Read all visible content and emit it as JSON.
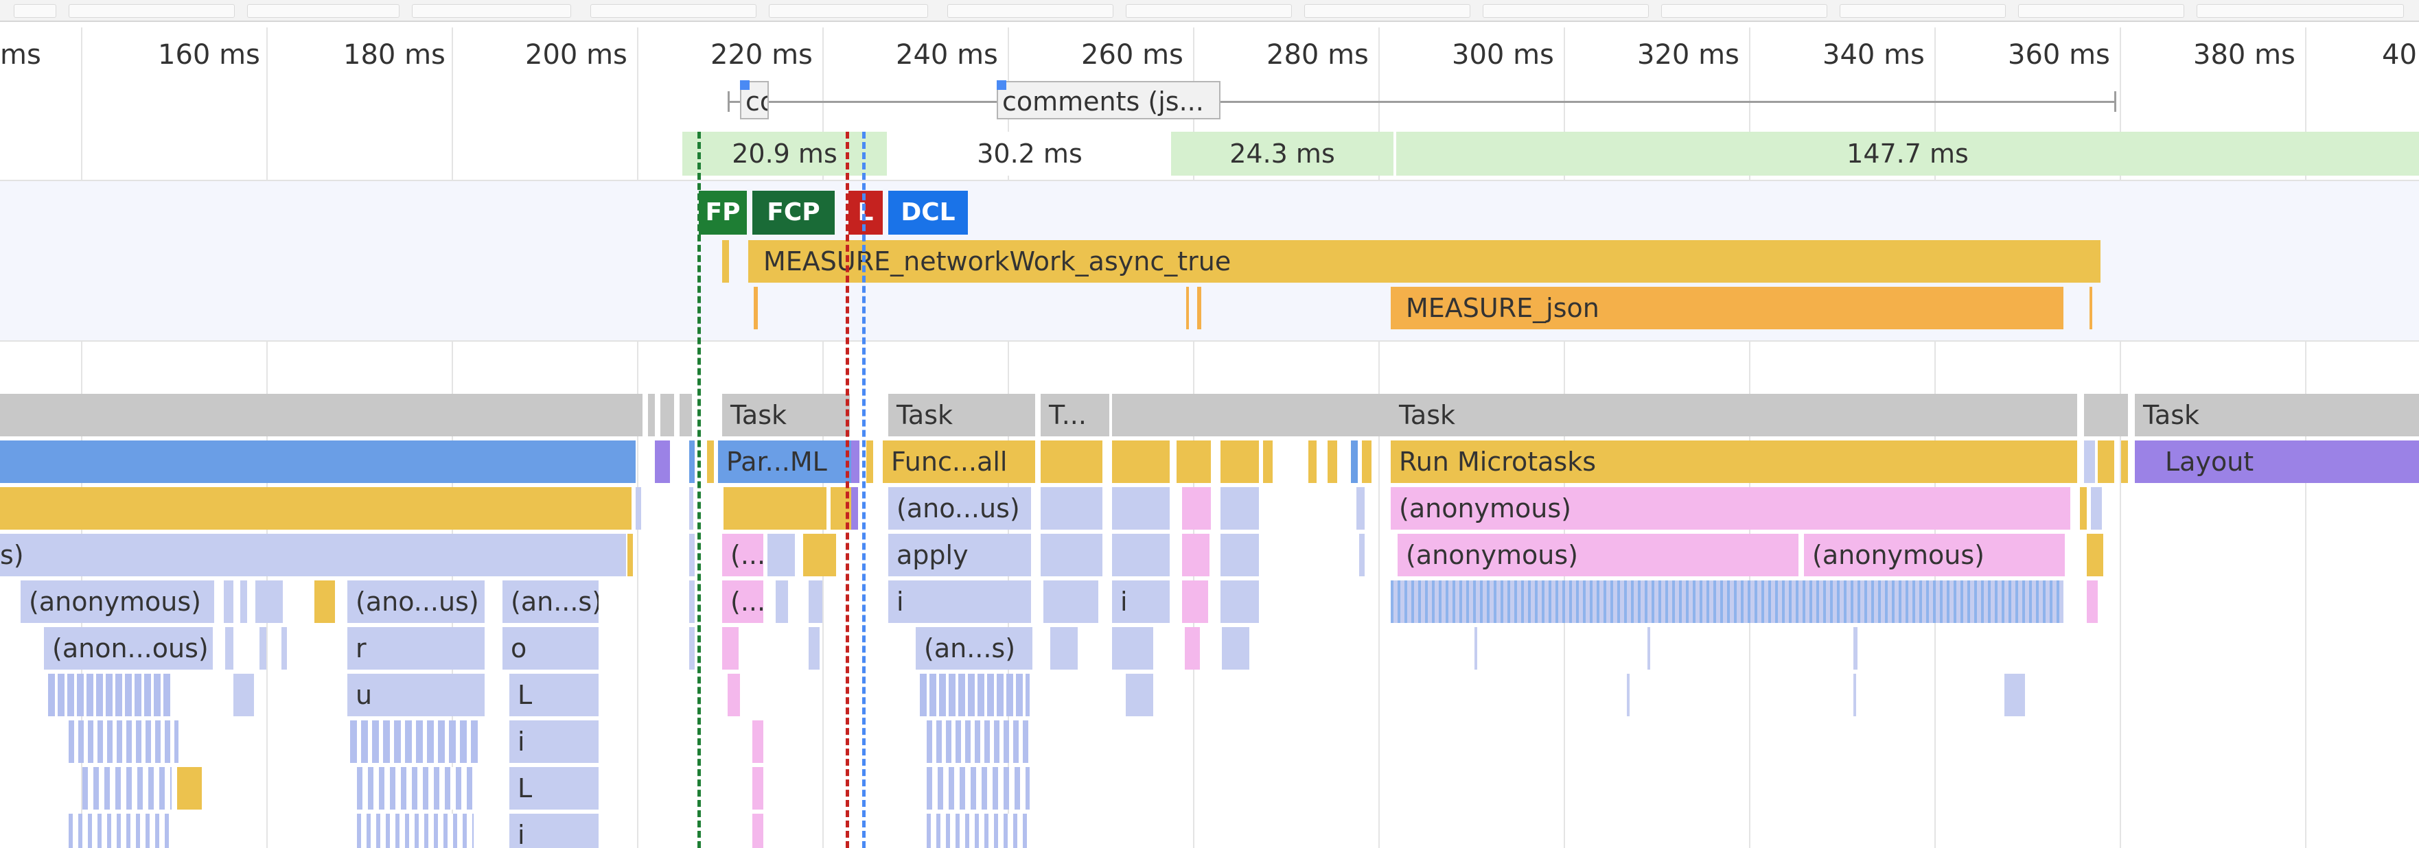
{
  "ruler": {
    "ticks": [
      "ms",
      "160 ms",
      "180 ms",
      "200 ms",
      "220 ms",
      "240 ms",
      "260 ms",
      "280 ms",
      "300 ms",
      "320 ms",
      "340 ms",
      "360 ms",
      "380 ms",
      "40"
    ]
  },
  "network": {
    "requests": [
      {
        "label": "co"
      },
      {
        "label": "comments (js..."
      }
    ]
  },
  "frames": [
    "20.9 ms",
    "30.2 ms",
    "24.3 ms",
    "147.7 ms"
  ],
  "timings": {
    "markers": [
      {
        "label": "FP",
        "color": "#1e7e34"
      },
      {
        "label": "FCP",
        "color": "#1a6b37"
      },
      {
        "label": "L",
        "color": "#c5221f"
      },
      {
        "label": "DCL",
        "color": "#1a73e8"
      }
    ],
    "measures": [
      {
        "label": "MEASURE_networkWork_async_true",
        "color": "#ecc24e"
      },
      {
        "label": "MEASURE_json",
        "color": "#f4b04a"
      }
    ]
  },
  "flame": {
    "row0": [
      "Task",
      "Task",
      "T...",
      "Task",
      "Task"
    ],
    "row1": [
      "Par...ML",
      "Func...all",
      "Run Microtasks",
      "Layout"
    ],
    "row2": [
      "(ano...us)",
      "(anonymous)"
    ],
    "row3": [
      "s)",
      "(...",
      "apply",
      "(anonymous)",
      "(anonymous)"
    ],
    "row4": [
      "(anonymous)",
      "(ano...us)",
      "(an...s)",
      "(...",
      "i",
      "i"
    ],
    "row5": [
      "(anon...ous)",
      "r",
      "o",
      "(an...s)"
    ],
    "row6": [
      "u",
      "L"
    ],
    "row7": [
      "i"
    ],
    "row8": [
      "L"
    ],
    "row9": [
      "i"
    ]
  }
}
